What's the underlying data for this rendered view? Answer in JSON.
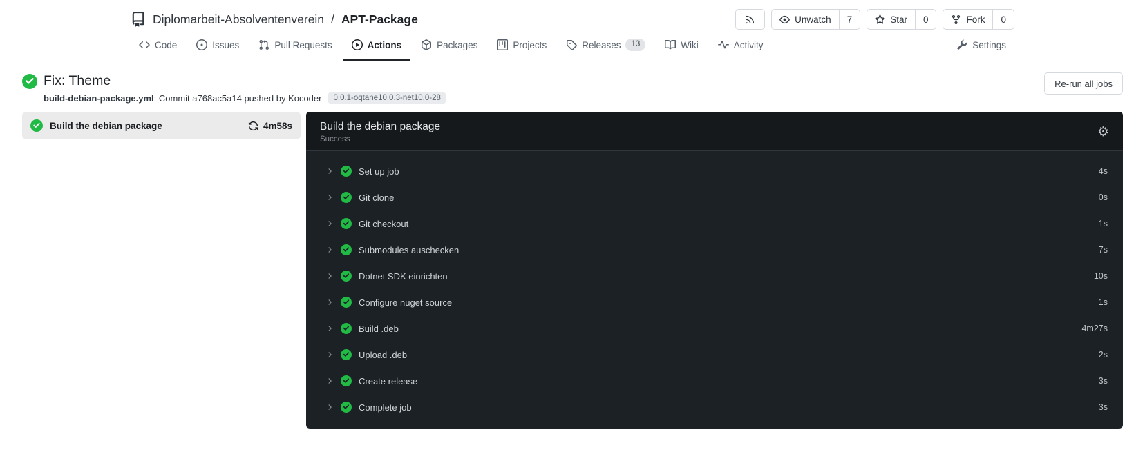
{
  "repo_header": {
    "owner": "Diplomarbeit-Absolventenverein",
    "separator": "/",
    "name": "APT-Package",
    "buttons": {
      "unwatch_label": "Unwatch",
      "unwatch_count": "7",
      "star_label": "Star",
      "star_count": "0",
      "fork_label": "Fork",
      "fork_count": "0"
    }
  },
  "tabs": {
    "items": [
      {
        "label": "Code"
      },
      {
        "label": "Issues"
      },
      {
        "label": "Pull Requests"
      },
      {
        "label": "Actions",
        "active": true
      },
      {
        "label": "Packages"
      },
      {
        "label": "Projects"
      },
      {
        "label": "Releases",
        "badge": "13"
      },
      {
        "label": "Wiki"
      },
      {
        "label": "Activity"
      }
    ],
    "settings_label": "Settings"
  },
  "run": {
    "title": "Fix: Theme",
    "workflow_file": "build-debian-package.yml",
    "subtitle_rest": ": Commit a768ac5a14 pushed by Kocoder",
    "ref_badge": "0.0.1-oqtane10.0.3-net10.0-28",
    "rerun_button_label": "Re-run all jobs"
  },
  "job": {
    "name": "Build the debian package",
    "duration": "4m58s"
  },
  "panel": {
    "title": "Build the debian package",
    "status": "Success",
    "gear_icon": "⚙",
    "steps": [
      {
        "name": "Set up job",
        "duration": "4s"
      },
      {
        "name": "Git clone",
        "duration": "0s"
      },
      {
        "name": "Git checkout",
        "duration": "1s"
      },
      {
        "name": "Submodules auschecken",
        "duration": "7s"
      },
      {
        "name": "Dotnet SDK einrichten",
        "duration": "10s"
      },
      {
        "name": "Configure nuget source",
        "duration": "1s"
      },
      {
        "name": "Build .deb",
        "duration": "4m27s"
      },
      {
        "name": "Upload .deb",
        "duration": "2s"
      },
      {
        "name": "Create release",
        "duration": "3s"
      },
      {
        "name": "Complete job",
        "duration": "3s"
      }
    ]
  },
  "colors": {
    "success_green": "#21ba45",
    "panel_body": "#1c2126",
    "panel_header": "#16191c"
  }
}
